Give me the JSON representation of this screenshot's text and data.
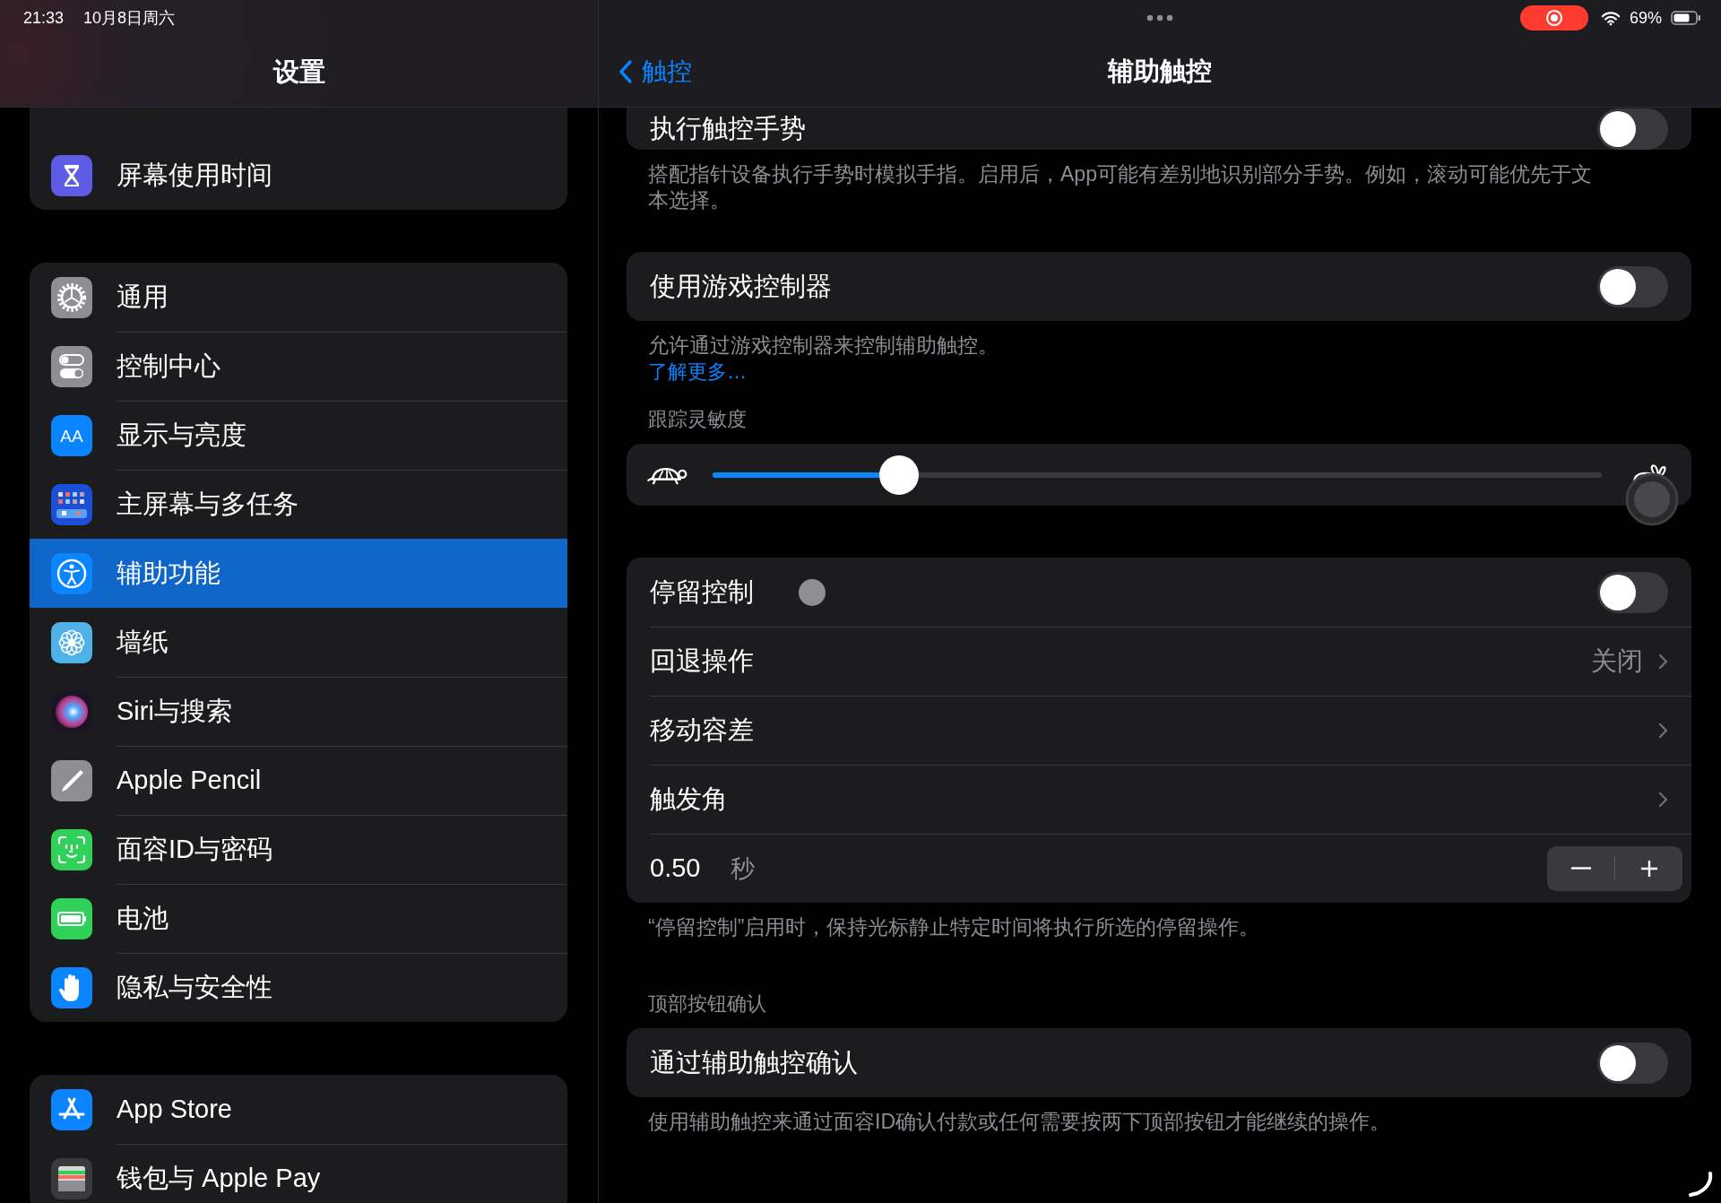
{
  "status_bar": {
    "time": "21:33",
    "date": "10月8日周六",
    "battery": "69%"
  },
  "sidebar": {
    "title": "设置",
    "groups": [
      {
        "items": [
          {
            "kind": "hourglass",
            "label": "屏幕使用时间",
            "selected": false
          }
        ]
      },
      {
        "items": [
          {
            "kind": "gear",
            "label": "通用",
            "selected": false
          },
          {
            "kind": "switches",
            "label": "控制中心",
            "selected": false
          },
          {
            "kind": "text",
            "icon_text": "AA",
            "label": "显示与亮度",
            "selected": false
          },
          {
            "kind": "grid",
            "label": "主屏幕与多任务",
            "selected": false
          },
          {
            "kind": "accessibility",
            "label": "辅助功能",
            "selected": true
          },
          {
            "kind": "flower",
            "label": "墙纸",
            "selected": false
          },
          {
            "kind": "orb",
            "label": "Siri与搜索",
            "selected": false
          },
          {
            "kind": "pencil",
            "label": "Apple Pencil",
            "selected": false
          },
          {
            "kind": "face",
            "label": "面容ID与密码",
            "selected": false
          },
          {
            "kind": "battery",
            "label": "电池",
            "selected": false
          },
          {
            "kind": "hand",
            "label": "隐私与安全性",
            "selected": false
          }
        ]
      },
      {
        "items": [
          {
            "kind": "appstore",
            "label": "App Store",
            "selected": false
          },
          {
            "kind": "wallet",
            "label": "钱包与 Apple Pay",
            "selected": false
          }
        ]
      }
    ]
  },
  "detail": {
    "back": "触控",
    "title": "辅助触控",
    "sections": [
      {
        "rows": [
          {
            "kind": "toggle",
            "label": "执行触控手势",
            "on": false
          }
        ],
        "footer": "搭配指针设备执行手势时模拟手指。启用后，App可能有差别地识别部分手势。例如，滚动可能优先于文本选择。"
      },
      {
        "rows": [
          {
            "kind": "toggle",
            "label": "使用游戏控制器",
            "on": false
          }
        ],
        "footer": "允许通过游戏控制器来控制辅助触控。",
        "footer_link": "了解更多…"
      },
      {
        "header": "跟踪灵敏度",
        "rows": [
          {
            "kind": "slider",
            "level": 0.21
          }
        ]
      },
      {
        "rows": [
          {
            "kind": "toggle",
            "label": "停留控制",
            "on": false,
            "indicator": true
          },
          {
            "kind": "link",
            "label": "回退操作",
            "value": "关闭"
          },
          {
            "kind": "link",
            "label": "移动容差"
          },
          {
            "kind": "link",
            "label": "触发角"
          },
          {
            "kind": "stepper",
            "value": "0.50",
            "unit": "秒"
          }
        ],
        "footer": "“停留控制”启用时，保持光标静止特定时间将执行所选的停留操作。"
      },
      {
        "header": "顶部按钮确认",
        "rows": [
          {
            "kind": "toggle",
            "label": "通过辅助触控确认",
            "on": false
          }
        ],
        "footer": "使用辅助触控来通过面容ID确认付款或任何需要按两下顶部按钮才能继续的操作。"
      }
    ]
  }
}
